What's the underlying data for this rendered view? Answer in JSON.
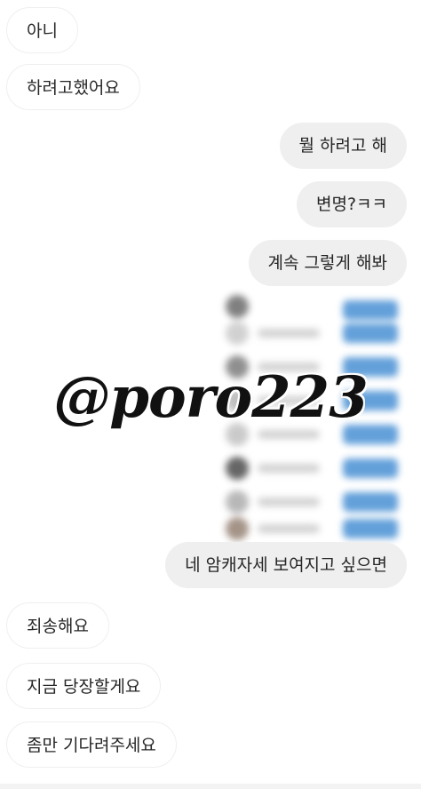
{
  "messages": [
    {
      "text": "아니"
    },
    {
      "text": "하려고했어요"
    },
    {
      "text": "뭘 하려고 해"
    },
    {
      "text": "변명?ㅋㅋ"
    },
    {
      "text": "계속 그렇게 해봐"
    },
    {
      "text": "네 암캐자세 보여지고 싶으면"
    },
    {
      "text": "죄송해요"
    },
    {
      "text": "지금 당장할게요"
    },
    {
      "text": "좀만 기다려주세요"
    }
  ],
  "watermark": "@poro223",
  "colors": {
    "outgoing_bubble": "#efefef",
    "incoming_border": "#efefef",
    "text": "#262626",
    "blurred_button": "#5b9bd8"
  }
}
